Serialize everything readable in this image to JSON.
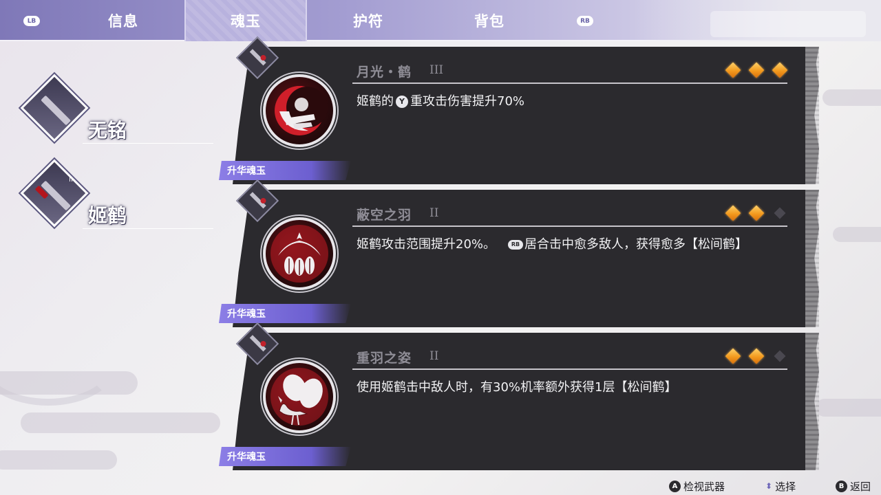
{
  "tabs": {
    "lb_badge": "LB",
    "rb_badge": "RB",
    "items": [
      {
        "label": "信息"
      },
      {
        "label": "魂玉"
      },
      {
        "label": "护符"
      },
      {
        "label": "背包"
      }
    ],
    "active_index": 1
  },
  "weapons": [
    {
      "name": "无铭",
      "icon": "dagger-icon"
    },
    {
      "name": "姬鹤",
      "icon": "katana-icon",
      "rank": "II"
    }
  ],
  "soul_jades": [
    {
      "title": "月光・鹤",
      "rank": "III",
      "stars_filled": 3,
      "stars_total": 3,
      "ribbon": "升华魂玉",
      "desc_before": "姬鹤的",
      "desc_button": "Y",
      "desc_after": "重攻击伤害提升70%",
      "emblem": "crescent-crane-emblem-icon"
    },
    {
      "title": "蔽空之羽",
      "rank": "II",
      "stars_filled": 2,
      "stars_total": 3,
      "ribbon": "升华魂玉",
      "desc_before": "姬鹤攻击范围提升20%。",
      "desc_button": "RB",
      "desc_after": "居合击中愈多敌人，获得愈多【松间鹤】",
      "emblem": "crane-feathers-emblem-icon"
    },
    {
      "title": "重羽之姿",
      "rank": "II",
      "stars_filled": 2,
      "stars_total": 3,
      "ribbon": "升华魂玉",
      "desc_before": "使用姬鹤击中敌人时，有30%机率额外获得1层【松间鹤】",
      "desc_button": "",
      "desc_after": "",
      "emblem": "crane-leaves-emblem-icon"
    }
  ],
  "footer": {
    "inspect": {
      "button": "A",
      "label": "检视武器"
    },
    "select": {
      "label": "选择"
    },
    "back": {
      "button": "B",
      "label": "返回"
    }
  },
  "colors": {
    "accent": "#7f78b8",
    "panel": "#2b2a2e",
    "star_on": "#f39a1e",
    "ribbon": "#6c5fd0"
  }
}
